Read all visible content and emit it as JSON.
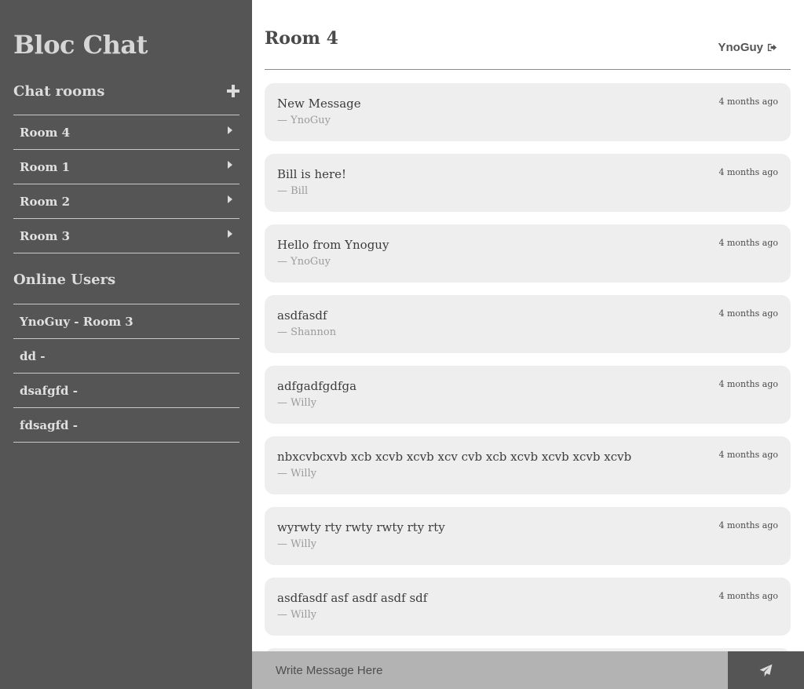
{
  "sidebar": {
    "app_title": "Bloc Chat",
    "rooms_title": "Chat rooms",
    "add_room_icon": "plus-icon",
    "rooms": [
      {
        "label": "Room 4"
      },
      {
        "label": "Room 1"
      },
      {
        "label": "Room 2"
      },
      {
        "label": "Room 3"
      }
    ],
    "online_title": "Online Users",
    "users": [
      {
        "label": "YnoGuy - Room 3"
      },
      {
        "label": "dd -"
      },
      {
        "label": "dsafgfd -"
      },
      {
        "label": "fdsagfd -"
      }
    ]
  },
  "main": {
    "room_title": "Room 4",
    "current_user": "YnoGuy",
    "logout_icon": "sign-out-icon",
    "messages": [
      {
        "content": "New Message",
        "author": "— YnoGuy",
        "time": "4 months ago"
      },
      {
        "content": "Bill is here!",
        "author": "— Bill",
        "time": "4 months ago"
      },
      {
        "content": "Hello from Ynoguy",
        "author": "— YnoGuy",
        "time": "4 months ago"
      },
      {
        "content": "asdfasdf",
        "author": "— Shannon",
        "time": "4 months ago"
      },
      {
        "content": "adfgadfgdfga",
        "author": "— Willy",
        "time": "4 months ago"
      },
      {
        "content": "nbxcvbcxvb xcb xcvb xcvb xcv cvb xcb xcvb xcvb xcvb xcvb",
        "author": "— Willy",
        "time": "4 months ago"
      },
      {
        "content": "wyrwty rty rwty rwty rty rty",
        "author": "— Willy",
        "time": "4 months ago"
      },
      {
        "content": "asdfasdf asf asdf asdf sdf",
        "author": "— Willy",
        "time": "4 months ago"
      }
    ],
    "composer": {
      "placeholder": "Write Message Here",
      "send_icon": "paper-plane-icon"
    }
  },
  "colors": {
    "sidebar_bg": "#555555",
    "message_bg": "#eeeeee",
    "composer_bg": "#b3b3b3"
  }
}
